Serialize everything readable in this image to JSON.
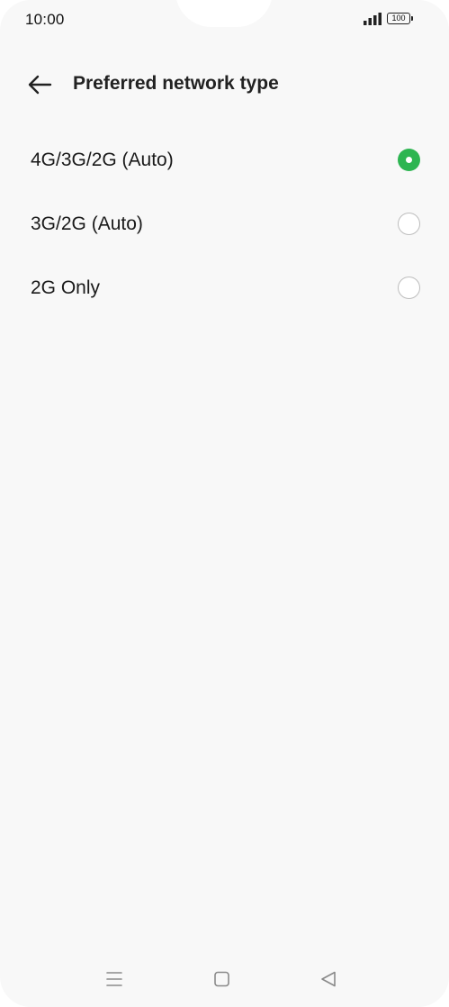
{
  "status_bar": {
    "time": "10:00",
    "battery": "100",
    "signal_icon": "signal-icon",
    "battery_icon": "battery-icon"
  },
  "header": {
    "title": "Preferred network type",
    "back_icon": "arrow-left-icon"
  },
  "options": [
    {
      "label": "4G/3G/2G (Auto)",
      "selected": true
    },
    {
      "label": "3G/2G (Auto)",
      "selected": false
    },
    {
      "label": "2G Only",
      "selected": false
    }
  ],
  "nav_bar": {
    "menu_icon": "menu-icon",
    "home_icon": "home-square-icon",
    "back_icon": "back-triangle-icon"
  },
  "colors": {
    "background": "#f8f8f8",
    "accent": "#2db551",
    "text": "#1a1a1a"
  }
}
